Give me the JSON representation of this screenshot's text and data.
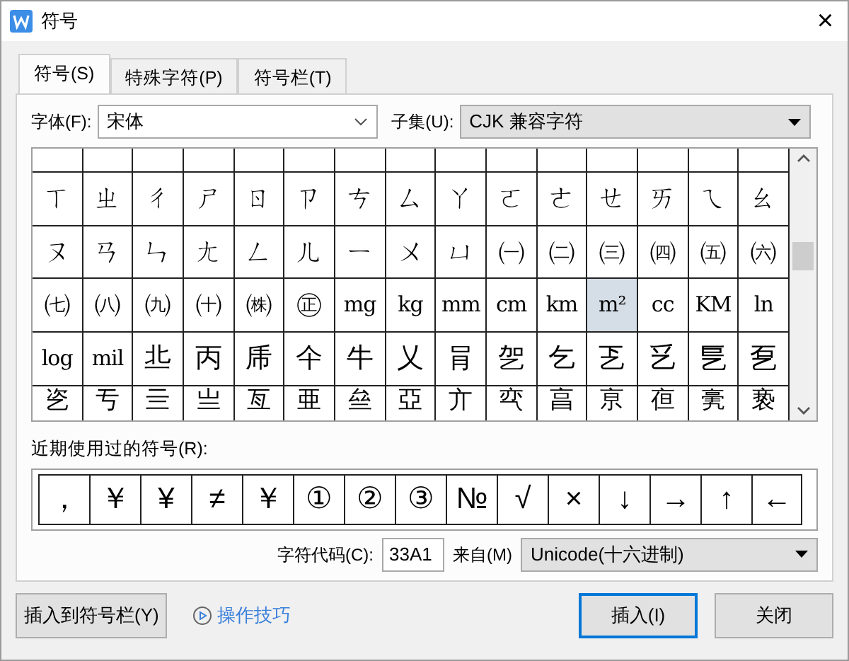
{
  "window": {
    "title": "符号",
    "close": "×"
  },
  "tabs": [
    {
      "label": "符号(S)",
      "selected": true
    },
    {
      "label": "特殊字符(P)",
      "selected": false
    },
    {
      "label": "符号栏(T)",
      "selected": false
    }
  ],
  "font": {
    "label": "字体(F):",
    "value": "宋体"
  },
  "subset": {
    "label": "子集(U):",
    "value": "CJK 兼容字符"
  },
  "symbol_grid": {
    "rows": [
      [
        {
          "char": "ㄒ",
          "selected": false
        },
        {
          "char": "ㄓ",
          "selected": false
        },
        {
          "char": "ㄔ",
          "selected": false
        },
        {
          "char": "ㄕ",
          "selected": false
        },
        {
          "char": "ㄖ",
          "selected": false
        },
        {
          "char": "ㄗ",
          "selected": false
        },
        {
          "char": "ㄘ",
          "selected": false
        },
        {
          "char": "ㄙ",
          "selected": false
        },
        {
          "char": "ㄚ",
          "selected": false
        },
        {
          "char": "ㄛ",
          "selected": false
        },
        {
          "char": "ㄜ",
          "selected": false
        },
        {
          "char": "ㄝ",
          "selected": false
        },
        {
          "char": "ㄞ",
          "selected": false
        },
        {
          "char": "ㄟ",
          "selected": false
        },
        {
          "char": "ㄠ",
          "selected": false
        }
      ],
      [
        {
          "char": "ㄡ",
          "selected": false
        },
        {
          "char": "ㄢ",
          "selected": false
        },
        {
          "char": "ㄣ",
          "selected": false
        },
        {
          "char": "ㄤ",
          "selected": false
        },
        {
          "char": "ㄥ",
          "selected": false
        },
        {
          "char": "ㄦ",
          "selected": false
        },
        {
          "char": "ㄧ",
          "selected": false
        },
        {
          "char": "ㄨ",
          "selected": false
        },
        {
          "char": "ㄩ",
          "selected": false
        },
        {
          "char": "㈠",
          "selected": false
        },
        {
          "char": "㈡",
          "selected": false
        },
        {
          "char": "㈢",
          "selected": false
        },
        {
          "char": "㈣",
          "selected": false
        },
        {
          "char": "㈤",
          "selected": false
        },
        {
          "char": "㈥",
          "selected": false
        }
      ],
      [
        {
          "char": "㈦",
          "selected": false
        },
        {
          "char": "㈧",
          "selected": false
        },
        {
          "char": "㈨",
          "selected": false
        },
        {
          "char": "㈩",
          "selected": false
        },
        {
          "char": "㈱",
          "selected": false
        },
        {
          "char": "㊣",
          "selected": false
        },
        {
          "char": "mg",
          "selected": false
        },
        {
          "char": "kg",
          "selected": false
        },
        {
          "char": "mm",
          "selected": false
        },
        {
          "char": "cm",
          "selected": false
        },
        {
          "char": "km",
          "selected": false
        },
        {
          "char": "m²",
          "selected": true
        },
        {
          "char": "cc",
          "selected": false
        },
        {
          "char": "KM",
          "selected": false
        },
        {
          "char": "ln",
          "selected": false
        }
      ],
      [
        {
          "char": "log",
          "selected": false
        },
        {
          "char": "mil",
          "selected": false
        },
        {
          "char": "丠",
          "selected": false
        },
        {
          "char": "丙",
          "selected": false
        },
        {
          "char": "乕",
          "selected": false
        },
        {
          "char": "仐",
          "selected": false
        },
        {
          "char": "牛",
          "selected": false
        },
        {
          "char": "乂",
          "selected": false
        },
        {
          "char": "肙",
          "selected": false
        },
        {
          "char": "乫",
          "selected": false
        },
        {
          "char": "乞",
          "selected": false
        },
        {
          "char": "乤",
          "selected": false
        },
        {
          "char": "乥",
          "selected": false
        },
        {
          "char": "乬",
          "selected": false
        },
        {
          "char": "乭",
          "selected": false
        }
      ],
      [
        {
          "char": "乲",
          "selected": false
        },
        {
          "char": "亐",
          "selected": false
        },
        {
          "char": "亖",
          "selected": false
        },
        {
          "char": "亗",
          "selected": false
        },
        {
          "char": "亙",
          "selected": false
        },
        {
          "char": "亜",
          "selected": false
        },
        {
          "char": "亝",
          "selected": false
        },
        {
          "char": "亞",
          "selected": false
        },
        {
          "char": "亣",
          "selected": false
        },
        {
          "char": "亪",
          "selected": false
        },
        {
          "char": "亯",
          "selected": false
        },
        {
          "char": "亰",
          "selected": false
        },
        {
          "char": "亱",
          "selected": false
        },
        {
          "char": "亴",
          "selected": false
        },
        {
          "char": "亵",
          "selected": false
        }
      ]
    ]
  },
  "recent": {
    "label": "近期使用过的符号(R):",
    "symbols": [
      "，",
      "￥",
      "¥",
      "≠",
      "￥",
      "①",
      "②",
      "③",
      "№",
      "√",
      "×",
      "↓",
      "→",
      "↑",
      "←"
    ]
  },
  "char_code": {
    "label": "字符代码(C):",
    "value": "33A1"
  },
  "source": {
    "label": "来自(M)",
    "value": "Unicode(十六进制)"
  },
  "buttons": {
    "insert_to_bar": "插入到符号栏(Y)",
    "tips": "操作技巧",
    "insert": "插入(I)",
    "close": "关闭"
  }
}
